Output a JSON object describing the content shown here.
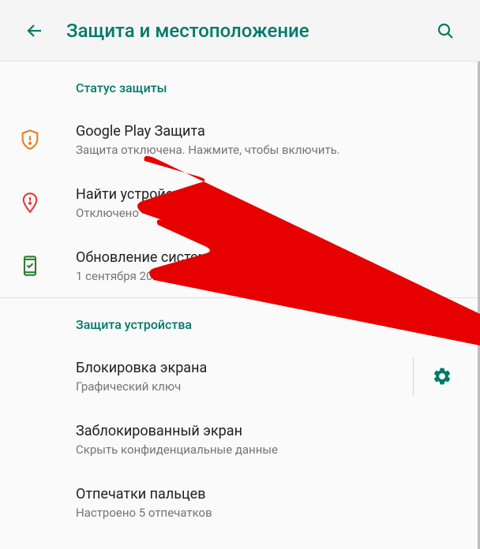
{
  "header": {
    "title": "Защита и местоположение"
  },
  "sections": {
    "status": {
      "header": "Статус защиты",
      "items": [
        {
          "title": "Google Play Защита",
          "subtitle": "Защита отключена. Нажмите, чтобы включить."
        },
        {
          "title": "Найти устройство",
          "subtitle": "Отключено"
        },
        {
          "title": "Обновление системы безопасности",
          "subtitle": "1 сентября 2019 г."
        }
      ]
    },
    "device": {
      "header": "Защита устройства",
      "items": [
        {
          "title": "Блокировка экрана",
          "subtitle": "Графический ключ"
        },
        {
          "title": "Заблокированный экран",
          "subtitle": "Скрыть конфиденциальные данные"
        },
        {
          "title": "Отпечатки пальцев",
          "subtitle": "Настроено 5 отпечатков"
        }
      ]
    }
  }
}
